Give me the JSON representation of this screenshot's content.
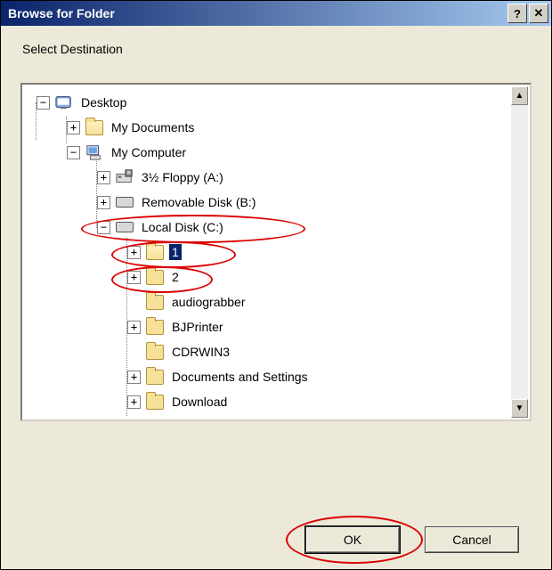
{
  "title": "Browse for Folder",
  "instruction": "Select Destination",
  "tree": {
    "desktop": "Desktop",
    "mydocs": "My Documents",
    "mycomp": "My Computer",
    "floppy": "3½ Floppy (A:)",
    "remov": "Removable Disk (B:)",
    "localc": "Local Disk (C:)",
    "f1": "1",
    "f2": "2",
    "audiograbber": "audiograbber",
    "bjprinter": "BJPrinter",
    "cdrwin": "CDRWIN3",
    "docsettings": "Documents and Settings",
    "download": "Download"
  },
  "buttons": {
    "ok": "OK",
    "cancel": "Cancel"
  },
  "titlebar": {
    "help": "?",
    "close": "✕"
  }
}
